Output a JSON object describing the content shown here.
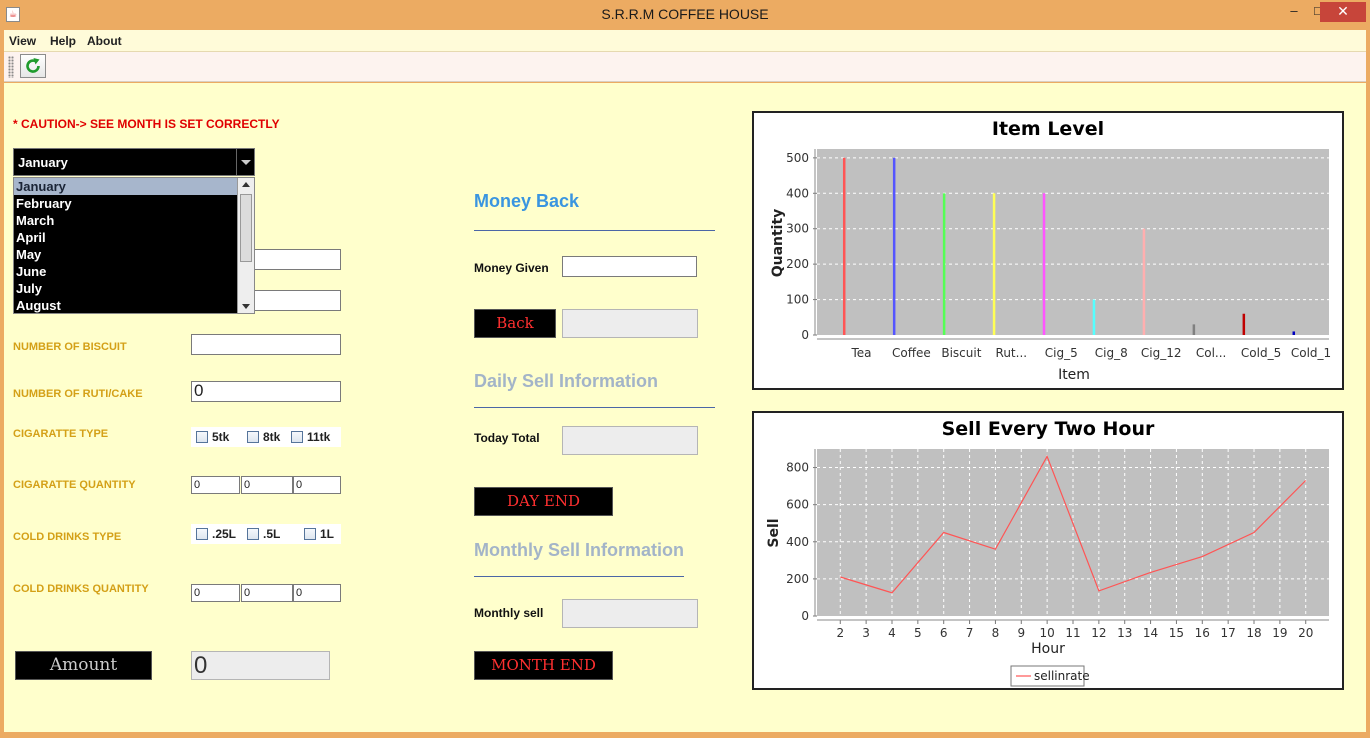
{
  "window": {
    "title": "S.R.R.M COFFEE HOUSE",
    "minimize": "–",
    "maximize": "□",
    "close": "✕"
  },
  "menu": [
    "View",
    "Help",
    "About"
  ],
  "form": {
    "caution": "* CAUTION-> SEE MONTH IS SET CORRECTLY",
    "month_selected": "January",
    "months_visible": [
      "January",
      "February",
      "March",
      "April",
      "May",
      "June",
      "July",
      "August"
    ],
    "biscuit_label": "NUMBER OF BISCUIT",
    "biscuit_value": "",
    "ruti_label": "NUMBER OF RUTI/CAKE",
    "ruti_value": "0",
    "cig_type_label": "CIGARATTE TYPE",
    "cig_types": [
      "5tk",
      "8tk",
      "11tk"
    ],
    "cig_qty_label": "CIGARATTE QUANTITY",
    "cig_qty": [
      "0",
      "0",
      "0"
    ],
    "cold_type_label": "COLD DRINKS TYPE",
    "cold_types": [
      ".25L",
      ".5L",
      "1L"
    ],
    "cold_qty_label": "COLD DRINKS QUANTITY",
    "cold_qty": [
      "0",
      "0",
      "0"
    ],
    "amount_button": "Amount",
    "amount_value": "0"
  },
  "money_back": {
    "title": "Money Back",
    "given_label": "Money Given",
    "back_button": "Back"
  },
  "daily": {
    "title": "Daily Sell Information",
    "today_label": "Today Total",
    "day_end_button": "DAY END"
  },
  "monthly": {
    "title": "Monthly Sell Information",
    "monthly_label": "Monthly sell",
    "month_end_button": "MONTH END"
  },
  "colors": {
    "window": "#ecab62",
    "content_bg": "#ffffcc",
    "plot_bg": "#c0c0c0",
    "accent_blue": "#3a95e0",
    "caution_red": "#e00000"
  },
  "chart_data": [
    {
      "type": "bar",
      "title": "Item Level",
      "xlabel": "Item",
      "ylabel": "Quantity",
      "categories": [
        "Tea",
        "Coffee",
        "Biscuit",
        "Rut...",
        "Cig_5",
        "Cig_8",
        "Cig_12",
        "Col...",
        "Cold_5",
        "Cold_1"
      ],
      "values": [
        500,
        500,
        400,
        400,
        400,
        100,
        300,
        30,
        60,
        10
      ],
      "colors": [
        "#ff5555",
        "#5555ff",
        "#55ff55",
        "#ffff55",
        "#ff55ff",
        "#55ffff",
        "#ffafaf",
        "#808080",
        "#c00000",
        "#0000c0"
      ],
      "yticks": [
        0,
        100,
        200,
        300,
        400,
        500
      ],
      "ylim": [
        0,
        525
      ],
      "grid": true
    },
    {
      "type": "line",
      "title": "Sell Every Two Hour",
      "xlabel": "Hour",
      "ylabel": "Sell",
      "xticks": [
        2,
        3,
        4,
        5,
        6,
        7,
        8,
        9,
        10,
        11,
        12,
        13,
        14,
        15,
        16,
        17,
        18,
        19,
        20
      ],
      "yticks": [
        0,
        200,
        400,
        600,
        800
      ],
      "xlim": [
        1.1,
        20.9
      ],
      "ylim": [
        0,
        900
      ],
      "series": [
        {
          "name": "sellinrate",
          "color": "#ff5555",
          "x": [
            2,
            4,
            6,
            8,
            10,
            12,
            14,
            16,
            18,
            20
          ],
          "y": [
            210,
            125,
            450,
            360,
            860,
            135,
            235,
            320,
            450,
            730
          ]
        }
      ],
      "legend": "bottom-center",
      "grid": true
    }
  ]
}
